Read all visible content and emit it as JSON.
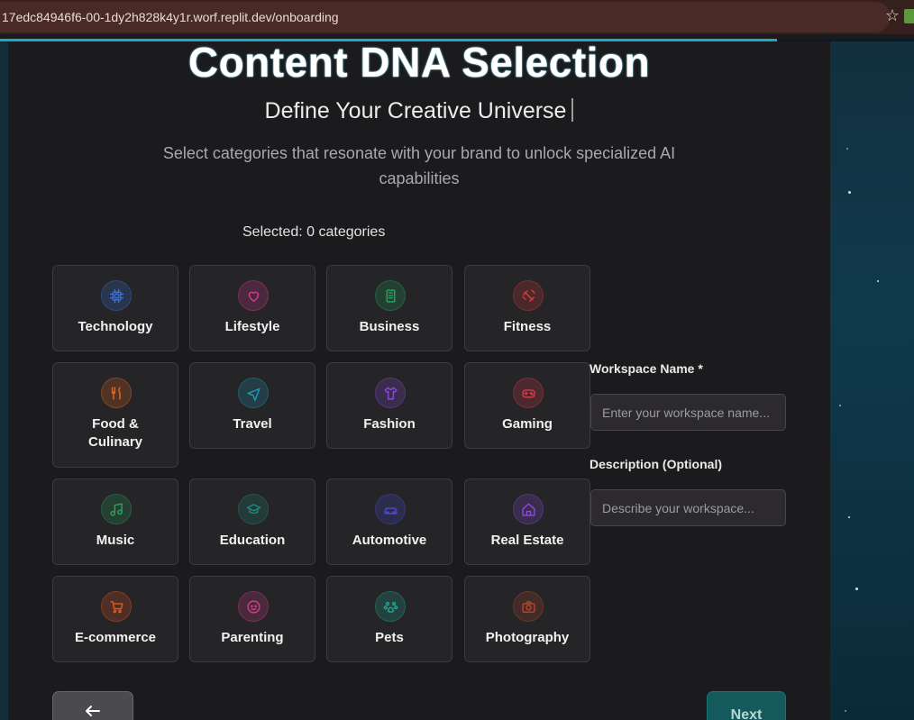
{
  "browser": {
    "url": "17edc84946f6-00-1dy2h828k4y1r.worf.replit.dev/onboarding"
  },
  "header": {
    "title": "Content DNA Selection",
    "subtitle": "Define Your Creative Universe",
    "description": "Select categories that resonate with your brand to unlock specialized AI capabilities",
    "selected_text": "Selected: 0 categories"
  },
  "categories": [
    {
      "label": "Technology",
      "icon": "cpu-icon",
      "color": "#3b6fd6"
    },
    {
      "label": "Lifestyle",
      "icon": "heart-icon",
      "color": "#d63b8f"
    },
    {
      "label": "Business",
      "icon": "building-icon",
      "color": "#23a35e"
    },
    {
      "label": "Fitness",
      "icon": "dumbbell-icon",
      "color": "#d63b3b"
    },
    {
      "label": "Food & Culinary",
      "icon": "utensils-icon",
      "color": "#e86a1e"
    },
    {
      "label": "Travel",
      "icon": "plane-icon",
      "color": "#1e9ab8"
    },
    {
      "label": "Fashion",
      "icon": "shirt-icon",
      "color": "#8a4ad6"
    },
    {
      "label": "Gaming",
      "icon": "gamepad-icon",
      "color": "#d63b4a"
    },
    {
      "label": "Music",
      "icon": "music-icon",
      "color": "#23a35e"
    },
    {
      "label": "Education",
      "icon": "graduation-cap-icon",
      "color": "#1f8a7a"
    },
    {
      "label": "Automotive",
      "icon": "car-icon",
      "color": "#4a4ad6"
    },
    {
      "label": "Real Estate",
      "icon": "home-icon",
      "color": "#8a4ad6"
    },
    {
      "label": "E-commerce",
      "icon": "cart-icon",
      "color": "#e8551e"
    },
    {
      "label": "Parenting",
      "icon": "baby-icon",
      "color": "#d63b8f"
    },
    {
      "label": "Pets",
      "icon": "paw-icon",
      "color": "#1fa890"
    },
    {
      "label": "Photography",
      "icon": "camera-icon",
      "color": "#b04a2e"
    }
  ],
  "form": {
    "workspace_label": "Workspace Name *",
    "workspace_placeholder": "Enter your workspace name...",
    "description_label": "Description (Optional)",
    "description_placeholder": "Describe your workspace..."
  },
  "nav": {
    "back_icon": "arrow-left-icon",
    "next_label": "Next"
  },
  "colors": {
    "accent": "#1ea8c4",
    "panel": "#1b1a1c",
    "next_button": "#145a5c"
  }
}
